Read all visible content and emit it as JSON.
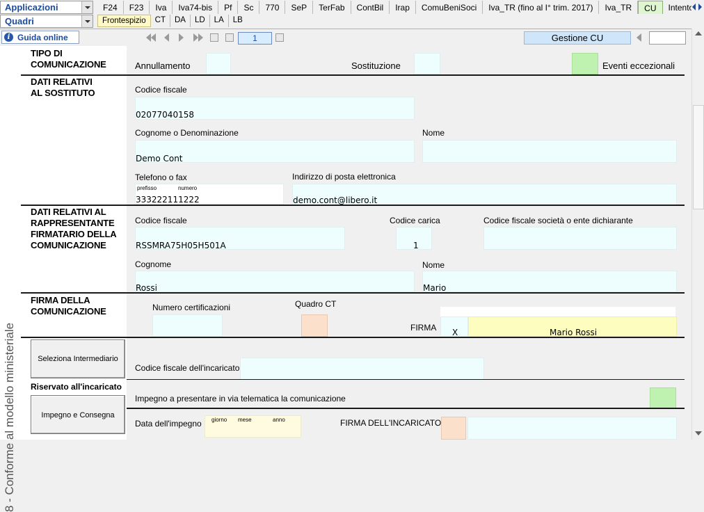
{
  "toolbar": {
    "applicazioni": "Applicazioni",
    "quadri": "Quadri",
    "tabs": [
      "F24",
      "F23",
      "Iva",
      "Iva74-bis",
      "Pf",
      "Sc",
      "770",
      "SeP",
      "TerFab",
      "ContBil",
      "Irap",
      "ComuBeniSoci",
      "Iva_TR (fino al I° trim. 2017)",
      "Iva_TR",
      "CU",
      "Intento (f"
    ],
    "subtabs": [
      "Frontespizio",
      "CT",
      "DA",
      "LD",
      "LA",
      "LB"
    ],
    "guide": "Guida online",
    "page": "1",
    "gestione": "Gestione CU"
  },
  "form": {
    "vertical_text": "8 - Conforme al modello ministeriale",
    "tipo": {
      "title": "TIPO DI\nCOMUNICAZIONE",
      "annullamento": "Annullamento",
      "sostituzione": "Sostituzione",
      "eventi": "Eventi eccezionali"
    },
    "sostituto": {
      "title": "DATI RELATIVI\nAL SOSTITUTO",
      "cf_label": "Codice fiscale",
      "cf_value": "02077040158",
      "cognome_label": "Cognome o Denominazione",
      "cognome_value": "Demo Cont",
      "nome_label": "Nome",
      "tel_label": "Telefono o fax",
      "prefisso": "prefisso",
      "numero": "numero",
      "tel_value": "333222111222",
      "email_label": "Indirizzo di posta elettronica",
      "email_value": "demo.cont@libero.it"
    },
    "rappresentante": {
      "title": "DATI RELATIVI AL\nRAPPRESENTANTE\nFIRMATARIO DELLA\nCOMUNICAZIONE",
      "cf_label": "Codice fiscale",
      "cf_value": "RSSMRA75H05H501A",
      "carica_label": "Codice carica",
      "carica_value": "1",
      "cf_soc_label": "Codice fiscale società o ente dichiarante",
      "cognome_label": "Cognome",
      "cognome_value": "Rossi",
      "nome_label": "Nome",
      "nome_value": "Mario"
    },
    "firma": {
      "title": "FIRMA DELLA\nCOMUNICAZIONE",
      "num_cert_label": "Numero certificazioni",
      "quadro_ct_label": "Quadro CT",
      "firma_label": "FIRMA",
      "firma_x": "X",
      "firma_value": "Mario Rossi"
    },
    "incaricato": {
      "seleziona_button": "Seleziona Intermediario",
      "cf_label": "Codice fiscale dell'incaricato",
      "riservato": "Riservato all'incaricato",
      "impegno_button": "Impegno e Consegna",
      "impegno_label": "Impegno a presentare in via telematica la comunicazione",
      "data_label": "Data dell'impegno",
      "giorno": "giorno",
      "mese": "mese",
      "anno": "anno",
      "firma_label": "FIRMA DELL'INCARICATO"
    }
  }
}
